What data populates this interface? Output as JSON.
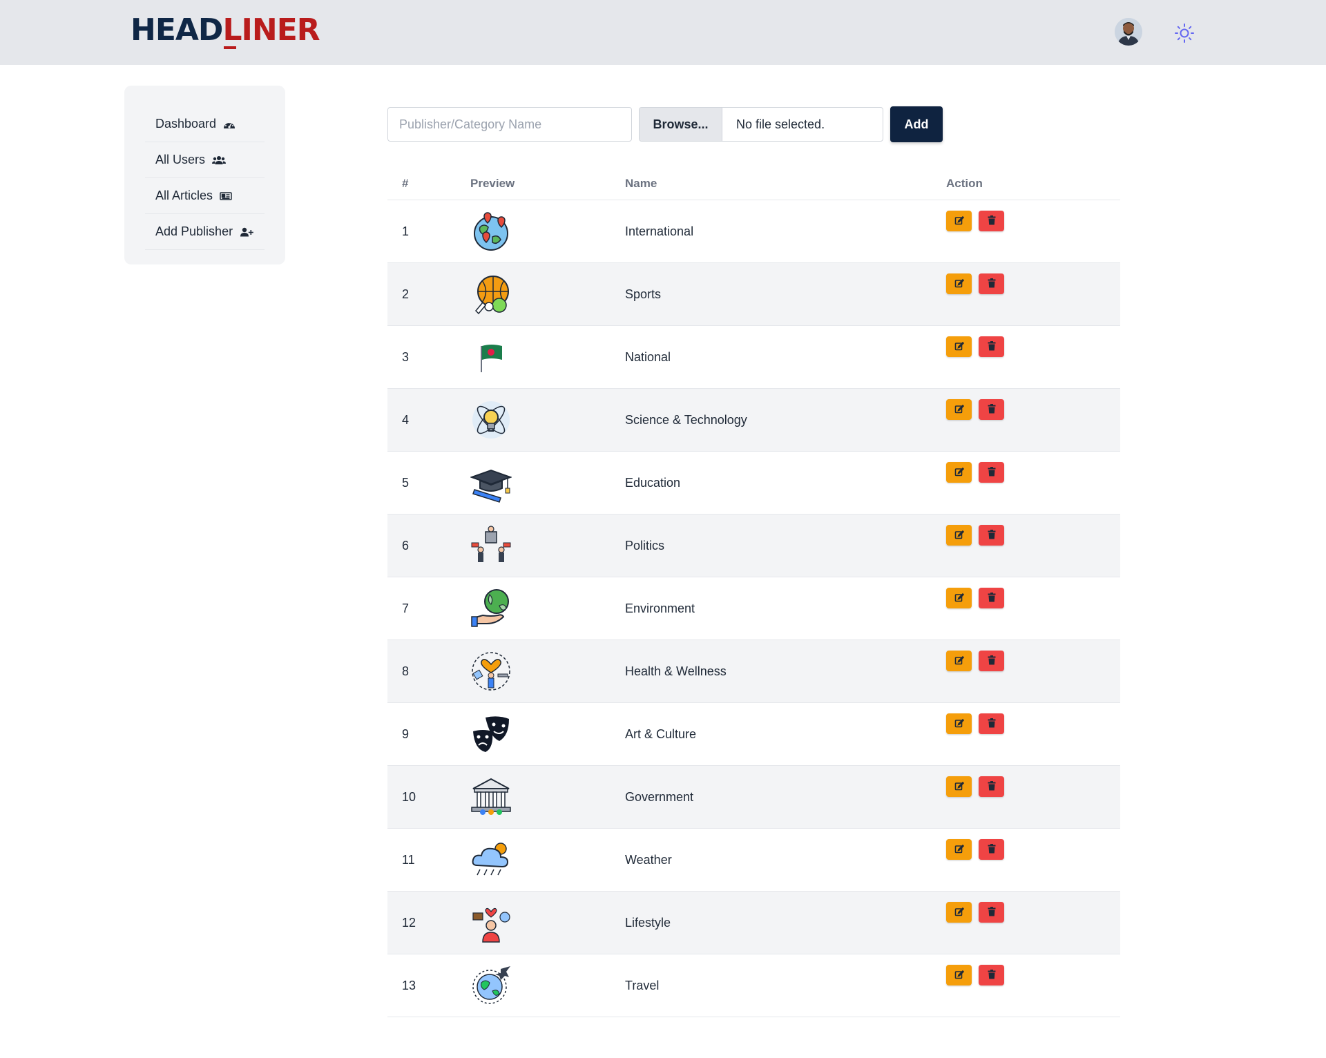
{
  "brand": {
    "part1": "HEAD",
    "part2": "LINER"
  },
  "header": {
    "avatar": "user-avatar",
    "theme_icon": "sun-icon"
  },
  "sidebar": {
    "items": [
      {
        "label": "Dashboard",
        "icon": "gauge-icon"
      },
      {
        "label": "All Users",
        "icon": "users-icon"
      },
      {
        "label": "All Articles",
        "icon": "newspaper-icon"
      },
      {
        "label": "Add Publisher",
        "icon": "user-plus-icon"
      }
    ]
  },
  "form": {
    "name_placeholder": "Publisher/Category Name",
    "name_value": "",
    "browse_label": "Browse...",
    "file_status": "No file selected.",
    "add_label": "Add"
  },
  "table": {
    "headers": [
      "#",
      "Preview",
      "Name",
      "Action"
    ],
    "rows": [
      {
        "num": "1",
        "name": "International",
        "icon": "globe-pins-icon"
      },
      {
        "num": "2",
        "name": "Sports",
        "icon": "sports-balls-icon"
      },
      {
        "num": "3",
        "name": "National",
        "icon": "bangladesh-flag-icon"
      },
      {
        "num": "4",
        "name": "Science & Technology",
        "icon": "atom-bulb-icon"
      },
      {
        "num": "5",
        "name": "Education",
        "icon": "graduation-cap-icon"
      },
      {
        "num": "6",
        "name": "Politics",
        "icon": "podium-protest-icon"
      },
      {
        "num": "7",
        "name": "Environment",
        "icon": "hand-earth-icon"
      },
      {
        "num": "8",
        "name": "Health & Wellness",
        "icon": "health-fitness-icon"
      },
      {
        "num": "9",
        "name": "Art & Culture",
        "icon": "theater-masks-icon"
      },
      {
        "num": "10",
        "name": "Government",
        "icon": "government-building-icon"
      },
      {
        "num": "11",
        "name": "Weather",
        "icon": "rain-cloud-icon"
      },
      {
        "num": "12",
        "name": "Lifestyle",
        "icon": "lifestyle-person-icon"
      },
      {
        "num": "13",
        "name": "Travel",
        "icon": "globe-plane-icon"
      }
    ],
    "edit_icon": "edit-icon",
    "delete_icon": "trash-icon"
  },
  "colors": {
    "brand_navy": "#0f2746",
    "brand_red": "#b91c1c",
    "edit": "#f59e0b",
    "delete": "#ef4444",
    "add_button": "#0f2340"
  }
}
